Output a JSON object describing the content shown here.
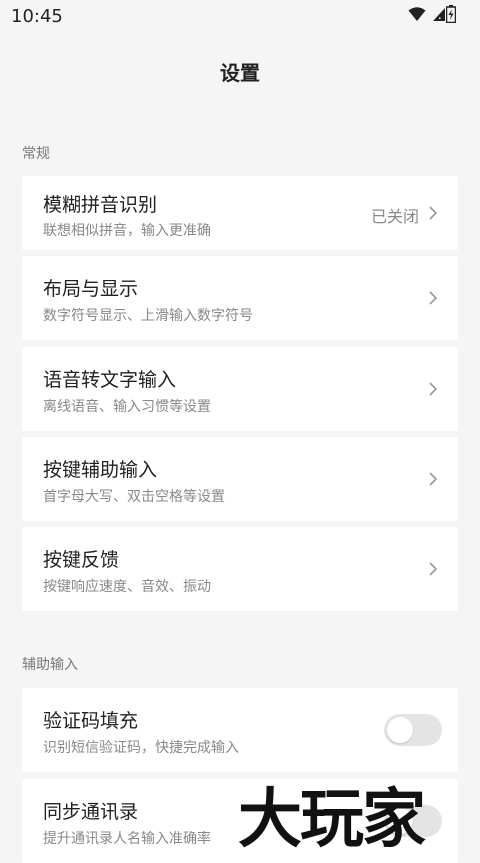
{
  "status_bar": {
    "time": "10:45"
  },
  "header": {
    "title": "设置"
  },
  "sections": [
    {
      "label": "常规",
      "items": [
        {
          "title": "模糊拼音识别",
          "subtitle": "联想相似拼音，输入更准确",
          "value": "已关闭"
        },
        {
          "title": "布局与显示",
          "subtitle": "数字符号显示、上滑输入数字符号"
        },
        {
          "title": "语音转文字输入",
          "subtitle": "离线语音、输入习惯等设置"
        },
        {
          "title": "按键辅助输入",
          "subtitle": "首字母大写、双击空格等设置"
        },
        {
          "title": "按键反馈",
          "subtitle": "按键响应速度、音效、振动"
        }
      ]
    },
    {
      "label": "辅助输入",
      "items": [
        {
          "title": "验证码填充",
          "subtitle": "识别短信验证码，快捷完成输入",
          "toggle": false
        },
        {
          "title": "同步通讯录",
          "subtitle": "提升通讯录人名输入准确率",
          "toggle": false
        }
      ]
    }
  ],
  "watermark": {
    "text": "大玩家"
  }
}
